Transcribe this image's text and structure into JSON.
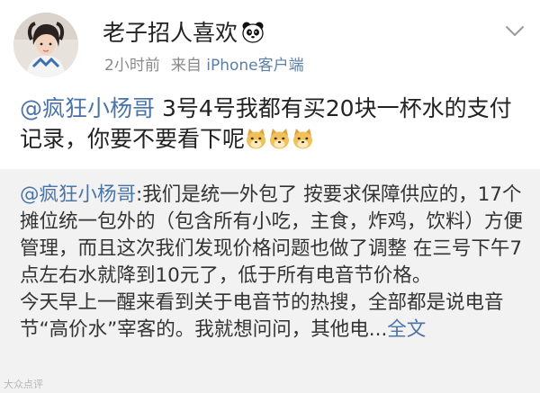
{
  "post": {
    "username": "老子招人喜欢",
    "time": "2小时前",
    "source_prefix": "来自",
    "source": "iPhone客户端",
    "text": {
      "mention": "@疯狂小杨哥",
      "body": " 3号4号我都有买20块一杯水的支付记录，你要不要看下呢"
    }
  },
  "quote": {
    "mention": "@疯狂小杨哥",
    "paragraph1": ":我们是统一外包了 按要求保障供应的，17个摊位统一包外的（包含所有小吃，主食，炸鸡，饮料）方便管理，而且这次我们发现价格问题也做了调整 在三号下午7点左右水就降到10元了，低于所有电音节价格。",
    "paragraph2": "今天早上一醒来看到关于电音节的热搜，全部都是说电音节“高价水”宰客的。我就想问问，其他电...",
    "full_text_link": "全文"
  },
  "watermark": "大众点评",
  "icons": {
    "emoji_after_name": "panda-icon",
    "emoji_after_text": "doge-icon",
    "menu": "chevron-down-icon"
  }
}
